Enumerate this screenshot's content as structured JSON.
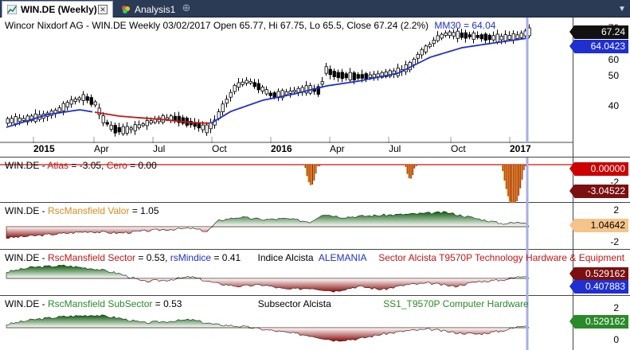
{
  "tabs": [
    {
      "label": "WIN.DE (Weekly)",
      "active": true
    },
    {
      "label": "Analysis1",
      "active": false
    }
  ],
  "main_chart": {
    "title": "Wincor Nixdorf AG - WIN.DE Weekly 03/02/2017 Open 65.77, Hi 67.75, Lo 65.5, Close 67.24 (2.2%)",
    "ma_label": "MM30 = 64.04",
    "y_ticks": [
      "70",
      "60",
      "50",
      "40"
    ],
    "price_tag": "67.24",
    "ma_tag": "64.0423",
    "x_labels": [
      {
        "text": "2015",
        "bold": true
      },
      {
        "text": "Apr",
        "bold": false
      },
      {
        "text": "Jul",
        "bold": false
      },
      {
        "text": "Oct",
        "bold": false
      },
      {
        "text": "2016",
        "bold": true
      },
      {
        "text": "Apr",
        "bold": false
      },
      {
        "text": "Jul",
        "bold": false
      },
      {
        "text": "Oct",
        "bold": false
      },
      {
        "text": "2017",
        "bold": true
      }
    ],
    "colors": {
      "up": "#ffffff",
      "down": "#000000",
      "ma_above": "#1f2fd0",
      "ma_below": "#c81414",
      "cursor": "#a8aee8"
    }
  },
  "atlas_panel": {
    "symbol": "WIN.DE - ",
    "name": "Atlas",
    "value_text": " = -3.05, ",
    "zero_name": "Cero",
    "zero_text": " = 0.00",
    "y_ticks": [
      "0",
      "-2"
    ],
    "tags": [
      "0.00000",
      "-3.04522"
    ]
  },
  "valor_panel": {
    "symbol": "WIN.DE - ",
    "name": "RscMansfield Valor",
    "value_text": " = 1.05",
    "y_ticks": [
      "2",
      "0",
      "-2"
    ],
    "tag": "1.04642"
  },
  "sector_panel": {
    "symbol": "WIN.DE - ",
    "name": "RscMansfield Sector",
    "value_text": " = 0.53, ",
    "index_name": "rsMindice",
    "index_value": " = 0.41",
    "index_label": "Indice Alcista",
    "index_country": "ALEMANIA",
    "sector_text": "Sector Alcista T9570P Technology Hardware & Equipment",
    "tags": [
      "0.529162",
      "0.407883"
    ]
  },
  "subsector_panel": {
    "symbol": "WIN.DE - ",
    "name": "RscMansfield SubSector",
    "value_text": " = 0.53",
    "subsector_label": "Subsector Alcista",
    "subsector_text": "SS1_T9570P Computer Hardware",
    "y_ticks": [
      "2",
      "0"
    ],
    "tag": "0.529162"
  }
}
